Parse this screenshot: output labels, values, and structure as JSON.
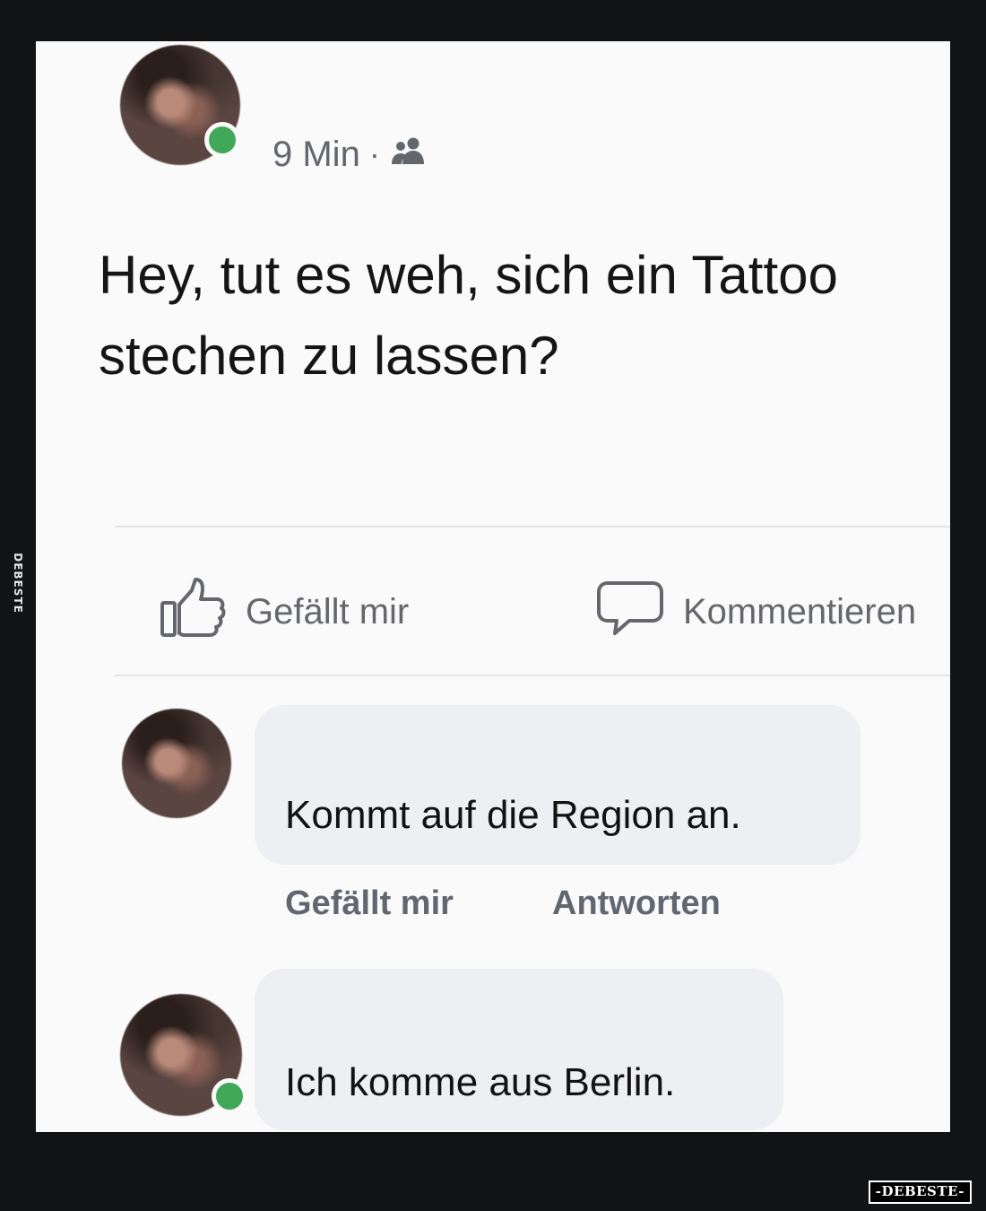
{
  "post": {
    "time": "9 Min",
    "separator": "·",
    "audience_icon": "friends-icon",
    "text": "Hey, tut es weh, sich ein Tattoo stechen zu lassen?"
  },
  "actions": {
    "like_label": "Gefällt mir",
    "like_icon": "thumbs-up-icon",
    "comment_label": "Kommentieren",
    "comment_icon": "comment-bubble-icon"
  },
  "comments": [
    {
      "text": "Kommt auf die Region an.",
      "like_label": "Gefällt mir",
      "reply_label": "Antworten"
    },
    {
      "text": "Ich komme aus Berlin."
    }
  ],
  "watermark": {
    "side": "DEBESTE",
    "badge": "-DEBESTE-"
  },
  "colors": {
    "online": "#41a85a",
    "bubble": "#eeeff3",
    "muted_text": "#65676b"
  }
}
